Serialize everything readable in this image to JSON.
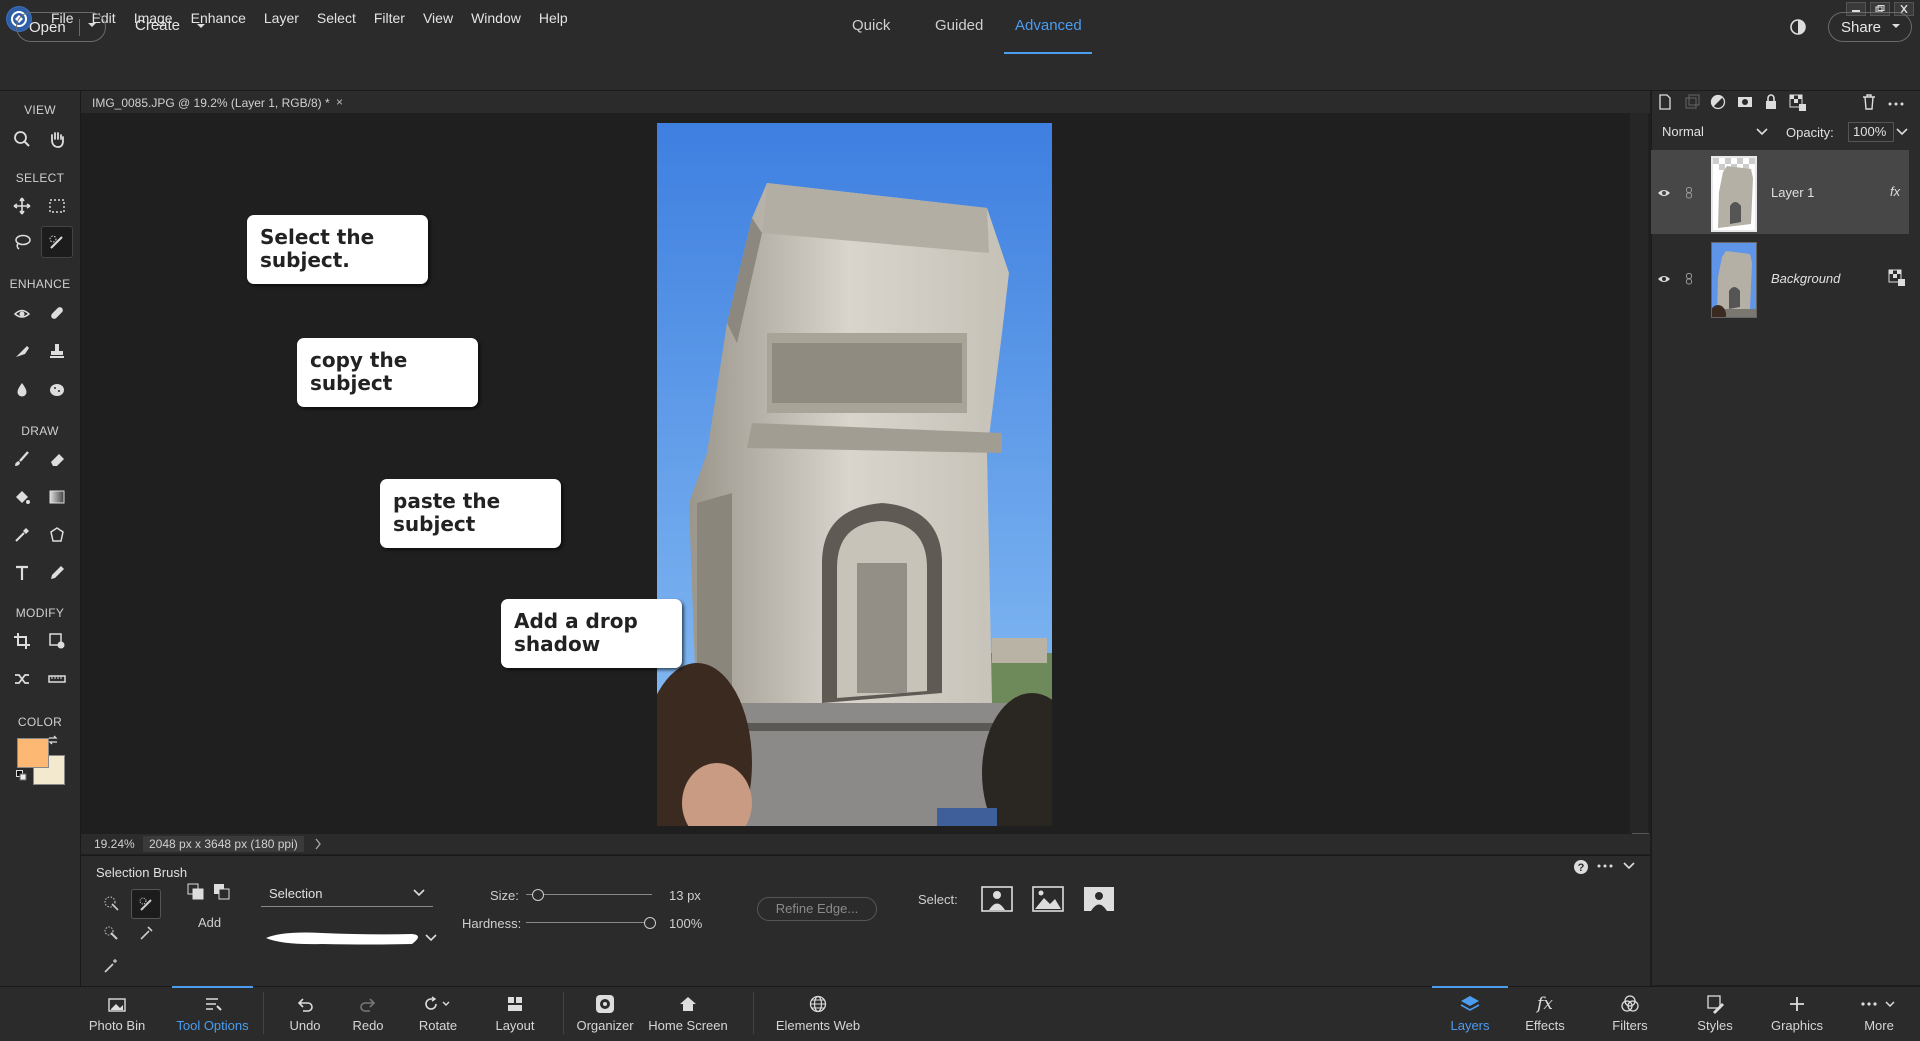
{
  "menu": [
    "File",
    "Edit",
    "Image",
    "Enhance",
    "Layer",
    "Select",
    "Filter",
    "View",
    "Window",
    "Help"
  ],
  "topbar": {
    "open_label": "Open",
    "create_label": "Create",
    "modes": [
      "Quick",
      "Guided",
      "Advanced"
    ],
    "active_mode": "Advanced",
    "share_label": "Share"
  },
  "toolbox": {
    "sections": [
      "VIEW",
      "SELECT",
      "ENHANCE",
      "DRAW",
      "MODIFY",
      "COLOR"
    ],
    "foreground_color": "#fdb874",
    "background_color": "#f3e9cf"
  },
  "document": {
    "tab_title": "IMG_0085.JPG @ 19.2% (Layer 1, RGB/8) *",
    "tab_close": "×",
    "zoom": "19.24%",
    "dimensions": "2048 px x 3648 px (180 ppi)"
  },
  "notes": [
    {
      "text": "Select the subject."
    },
    {
      "text": "copy the subject"
    },
    {
      "text": "paste the subject"
    },
    {
      "text": "Add a drop shadow"
    }
  ],
  "tool_options": {
    "title": "Selection Brush",
    "add_label": "Add",
    "mode_value": "Selection",
    "size_label": "Size:",
    "size_value": "13 px",
    "size_level": 0.05,
    "hardness_label": "Hardness:",
    "hardness_value": "100%",
    "hardness_level": 1.0,
    "refine_edge_label": "Refine Edge...",
    "select_label": "Select:"
  },
  "layers_panel": {
    "blend_mode": "Normal",
    "opacity_label": "Opacity:",
    "opacity_value": "100%",
    "layers": [
      {
        "name": "Layer 1",
        "selected": true
      },
      {
        "name": "Background",
        "selected": false
      }
    ]
  },
  "taskbar": {
    "left": [
      "Photo Bin",
      "Tool Options",
      "Undo",
      "Redo",
      "Rotate",
      "Layout",
      "Organizer",
      "Home Screen",
      "Elements Web"
    ],
    "right": [
      "Layers",
      "Effects",
      "Filters",
      "Styles",
      "Graphics",
      "More"
    ],
    "active_left": "Tool Options",
    "active_right": "Layers",
    "accent_color": "#4c9cf0"
  }
}
